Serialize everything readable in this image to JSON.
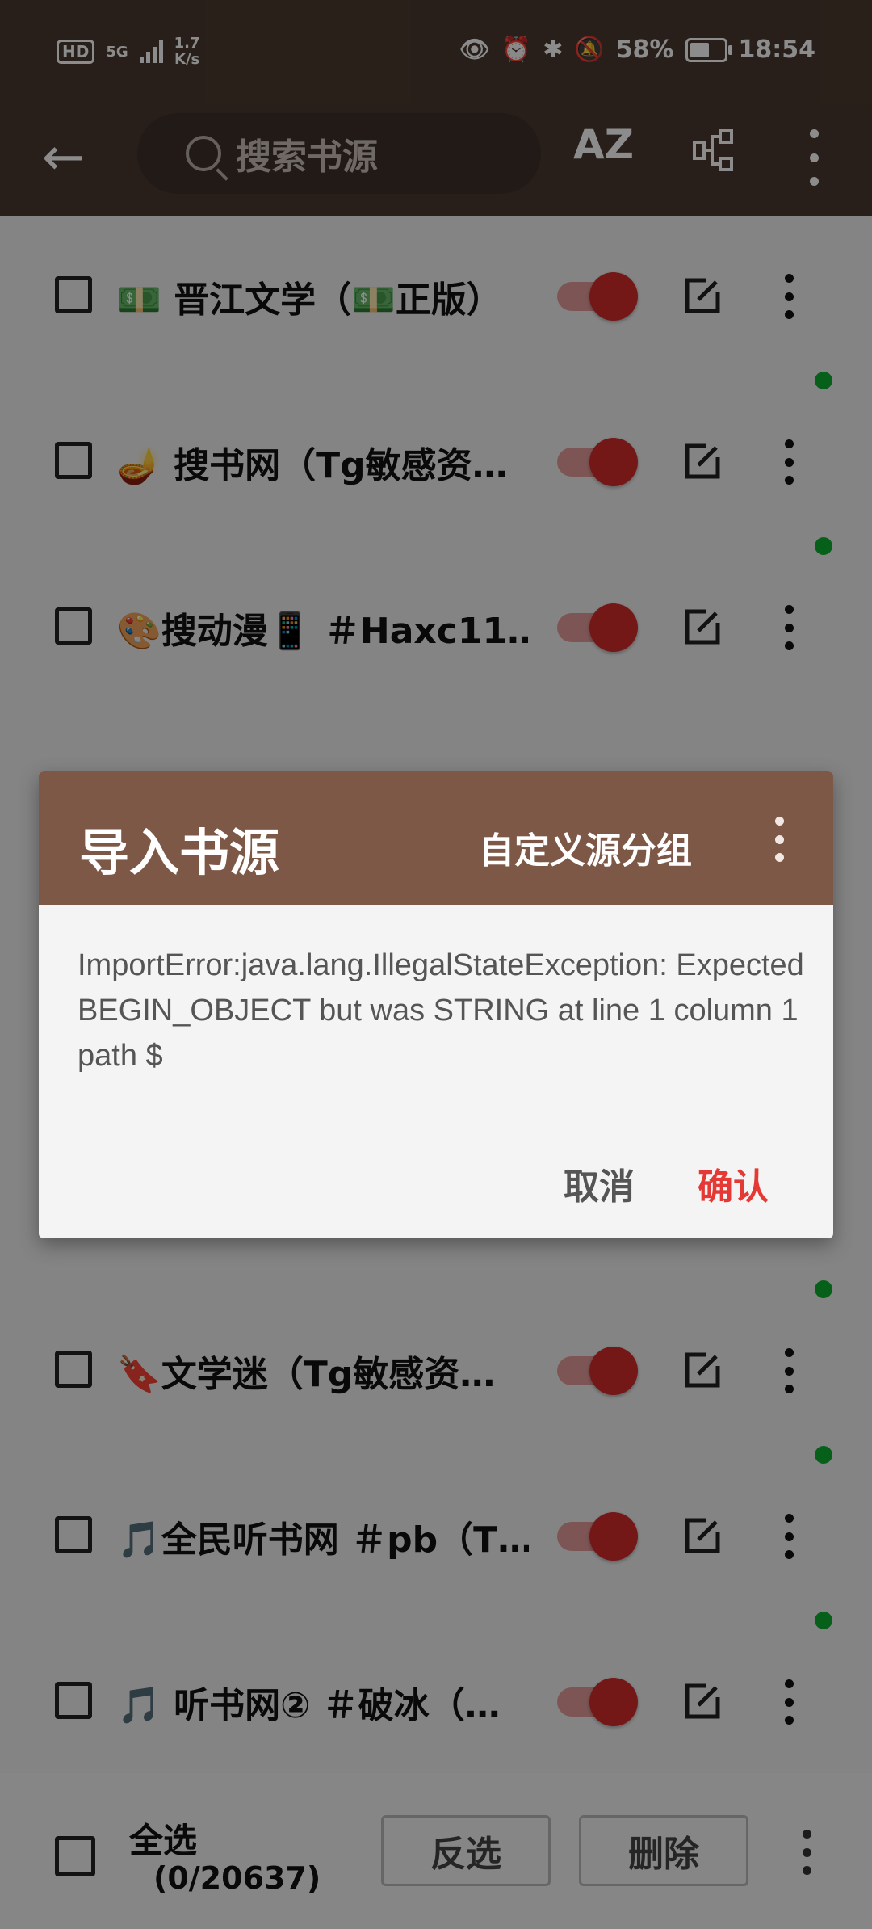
{
  "status_bar": {
    "hd": "HD",
    "network": "5G",
    "speed_value": "1.7",
    "speed_unit": "K/s",
    "battery": "58%",
    "time": "18:54"
  },
  "toolbar": {
    "search_placeholder": "搜索书源",
    "sort_label": "AZ"
  },
  "sources": [
    {
      "title": "💵 晋江文学（💵正版）",
      "enabled": true,
      "status_dot": false
    },
    {
      "title": "🪔 搜书网（Tg敏感资…",
      "enabled": true,
      "status_dot": true
    },
    {
      "title": "🎨搜动漫📱 ＃Haxc11…",
      "enabled": true,
      "status_dot": true
    },
    {
      "title": "🔖文学迷（Tg敏感资…",
      "enabled": true,
      "status_dot": true
    },
    {
      "title": "🎵全民听书网 ＃pb（T…",
      "enabled": true,
      "status_dot": true
    },
    {
      "title": "🎵 听书网② ＃破冰（…",
      "enabled": true,
      "status_dot": true
    }
  ],
  "bottom": {
    "select_all": "全选",
    "count": "(0/20637)",
    "invert": "反选",
    "delete": "删除"
  },
  "dialog": {
    "title": "导入书源",
    "custom_group": "自定义源分组",
    "message": "ImportError:java.lang.IllegalStateException: Expected BEGIN_OBJECT but was STRING at line 1 column 1 path $",
    "cancel": "取消",
    "confirm": "确认"
  },
  "colors": {
    "appbar": "#4a3a30",
    "dialog_header": "#7e5846",
    "switch_on": "#d32a2a",
    "status_dot": "#0bb02e",
    "confirm": "#e53935"
  }
}
